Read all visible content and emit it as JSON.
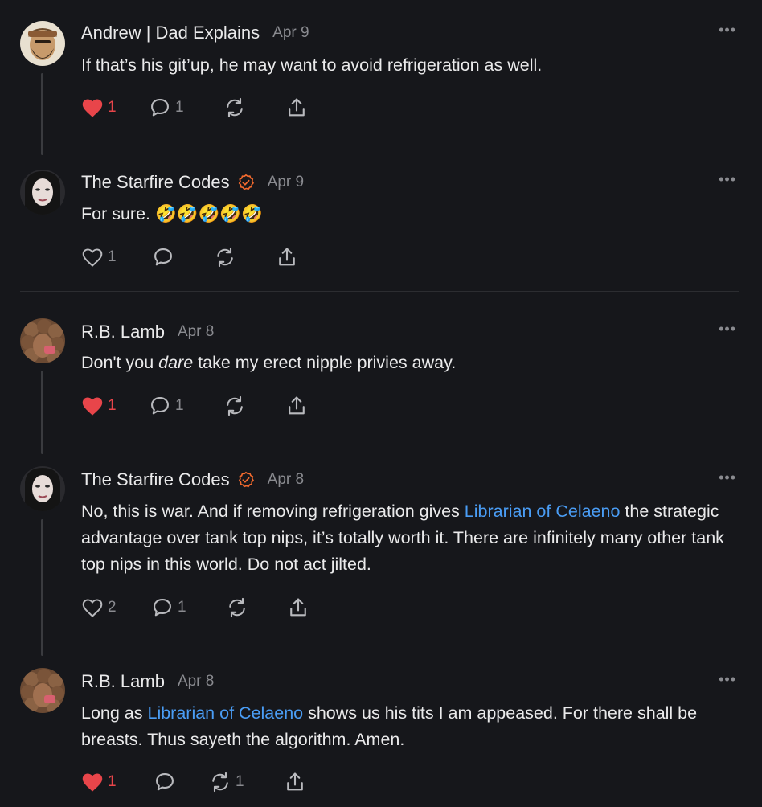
{
  "comments": [
    {
      "author": "Andrew | Dad Explains",
      "date": "Apr 9",
      "verified": false,
      "text": "If that’s his git’up, he may want to avoid refrigeration as well.",
      "likes": "1",
      "liked": true,
      "replies": "1",
      "restacks": ""
    },
    {
      "author": "The Starfire Codes",
      "date": "Apr 9",
      "verified": true,
      "text": "For sure. 🤣🤣🤣🤣🤣",
      "likes": "1",
      "liked": false,
      "replies": "",
      "restacks": ""
    },
    {
      "author": "R.B. Lamb",
      "date": "Apr 8",
      "verified": false,
      "text_parts": [
        "Don't you ",
        "dare",
        " take my erect nipple privies away."
      ],
      "likes": "1",
      "liked": true,
      "replies": "1",
      "restacks": ""
    },
    {
      "author": "The Starfire Codes",
      "date": "Apr 8",
      "verified": true,
      "text_parts": [
        "No, this is war. And if removing refrigeration gives ",
        "Librarian of Celaeno",
        " the strategic advantage over tank top nips, it’s totally worth it. There are infinitely many other tank top nips in this world. Do not act jilted."
      ],
      "likes": "2",
      "liked": false,
      "replies": "1",
      "restacks": ""
    },
    {
      "author": "R.B. Lamb",
      "date": "Apr 8",
      "verified": false,
      "text_parts": [
        "Long as ",
        "Librarian of Celaeno",
        " shows us his tits I am appeased. For there shall be breasts. Thus sayeth the algorithm. Amen."
      ],
      "likes": "1",
      "liked": true,
      "replies": "",
      "restacks": "1"
    }
  ],
  "more_label": "•••",
  "colors": {
    "accent_link": "#4a9df5",
    "like_red": "#e8454a",
    "verified_orange": "#f26a2e"
  }
}
